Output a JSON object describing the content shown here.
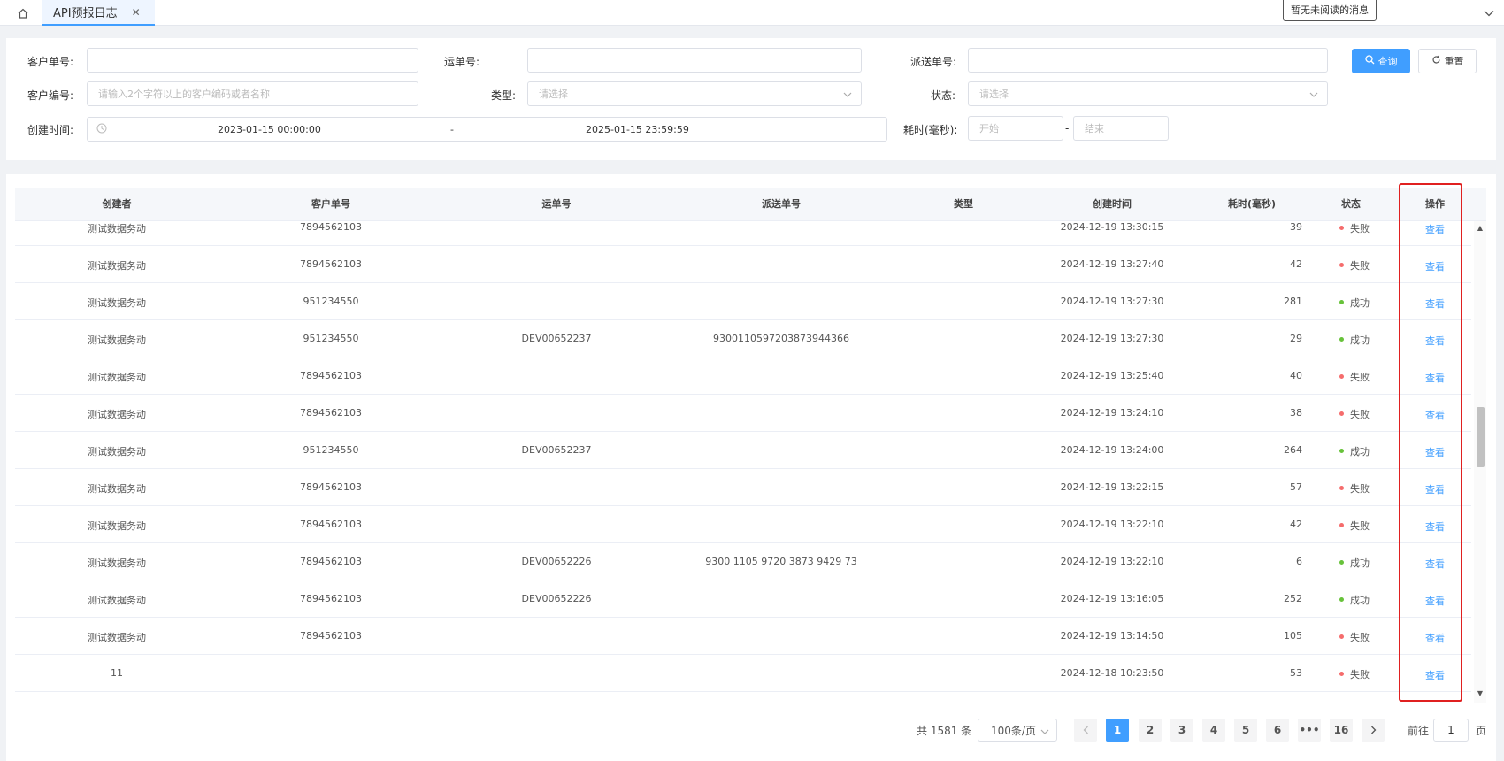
{
  "tabs": {
    "active_label": "API预报日志",
    "close": "✕"
  },
  "notice": "暂无未阅读的消息",
  "filter": {
    "customer_order_label": "客户单号:",
    "waybill_label": "运单号:",
    "dispatch_label": "派送单号:",
    "customer_code_label": "客户编号:",
    "customer_code_placeholder": "请输入2个字符以上的客户编码或者名称",
    "type_label": "类型:",
    "type_placeholder": "请选择",
    "status_label": "状态:",
    "status_placeholder": "请选择",
    "created_label": "创建时间:",
    "date_start": "2023-01-15 00:00:00",
    "date_sep": "-",
    "date_end": "2025-01-15 23:59:59",
    "cost_label": "耗时(毫秒):",
    "cost_start_placeholder": "开始",
    "cost_sep": "-",
    "cost_end_placeholder": "结束",
    "search_label": "查询",
    "reset_label": "重置"
  },
  "table": {
    "columns": [
      "创建者",
      "客户单号",
      "运单号",
      "派送单号",
      "类型",
      "创建时间",
      "耗时(毫秒)",
      "状态",
      "操作"
    ],
    "rows": [
      {
        "creator": "测试数据务动",
        "customer_no": "7894562103",
        "waybill": "",
        "dispatch": "",
        "type": "",
        "created": "2024-12-19 13:30:15",
        "cost": "39",
        "status": "失败",
        "action": "查看"
      },
      {
        "creator": "测试数据务动",
        "customer_no": "7894562103",
        "waybill": "",
        "dispatch": "",
        "type": "",
        "created": "2024-12-19 13:27:40",
        "cost": "42",
        "status": "失败",
        "action": "查看"
      },
      {
        "creator": "测试数据务动",
        "customer_no": "951234550",
        "waybill": "",
        "dispatch": "",
        "type": "",
        "created": "2024-12-19 13:27:30",
        "cost": "281",
        "status": "成功",
        "action": "查看"
      },
      {
        "creator": "测试数据务动",
        "customer_no": "951234550",
        "waybill": "DEV00652237",
        "dispatch": "9300110597203873944366",
        "type": "",
        "created": "2024-12-19 13:27:30",
        "cost": "29",
        "status": "成功",
        "action": "查看"
      },
      {
        "creator": "测试数据务动",
        "customer_no": "7894562103",
        "waybill": "",
        "dispatch": "",
        "type": "",
        "created": "2024-12-19 13:25:40",
        "cost": "40",
        "status": "失败",
        "action": "查看"
      },
      {
        "creator": "测试数据务动",
        "customer_no": "7894562103",
        "waybill": "",
        "dispatch": "",
        "type": "",
        "created": "2024-12-19 13:24:10",
        "cost": "38",
        "status": "失败",
        "action": "查看"
      },
      {
        "creator": "测试数据务动",
        "customer_no": "951234550",
        "waybill": "DEV00652237",
        "dispatch": "",
        "type": "",
        "created": "2024-12-19 13:24:00",
        "cost": "264",
        "status": "成功",
        "action": "查看"
      },
      {
        "creator": "测试数据务动",
        "customer_no": "7894562103",
        "waybill": "",
        "dispatch": "",
        "type": "",
        "created": "2024-12-19 13:22:15",
        "cost": "57",
        "status": "失败",
        "action": "查看"
      },
      {
        "creator": "测试数据务动",
        "customer_no": "7894562103",
        "waybill": "",
        "dispatch": "",
        "type": "",
        "created": "2024-12-19 13:22:10",
        "cost": "42",
        "status": "失败",
        "action": "查看"
      },
      {
        "creator": "测试数据务动",
        "customer_no": "7894562103",
        "waybill": "DEV00652226",
        "dispatch": "9300 1105 9720 3873 9429 73",
        "type": "",
        "created": "2024-12-19 13:22:10",
        "cost": "6",
        "status": "成功",
        "action": "查看"
      },
      {
        "creator": "测试数据务动",
        "customer_no": "7894562103",
        "waybill": "DEV00652226",
        "dispatch": "",
        "type": "",
        "created": "2024-12-19 13:16:05",
        "cost": "252",
        "status": "成功",
        "action": "查看"
      },
      {
        "creator": "测试数据务动",
        "customer_no": "7894562103",
        "waybill": "",
        "dispatch": "",
        "type": "",
        "created": "2024-12-19 13:14:50",
        "cost": "105",
        "status": "失败",
        "action": "查看"
      },
      {
        "creator": "11",
        "customer_no": "",
        "waybill": "",
        "dispatch": "",
        "type": "",
        "created": "2024-12-18 10:23:50",
        "cost": "53",
        "status": "失败",
        "action": "查看"
      }
    ]
  },
  "colors": {
    "success": "#67c23a",
    "fail": "#f56c6c",
    "primary": "#409eff",
    "highlight": "#e02020"
  },
  "pagination": {
    "total": "共 1581 条",
    "page_size": "100条/页",
    "pages": [
      "1",
      "2",
      "3",
      "4",
      "5",
      "6",
      "•••",
      "16"
    ],
    "current": "1",
    "goto_label": "前往",
    "goto_value": "1",
    "page_suffix": "页"
  }
}
